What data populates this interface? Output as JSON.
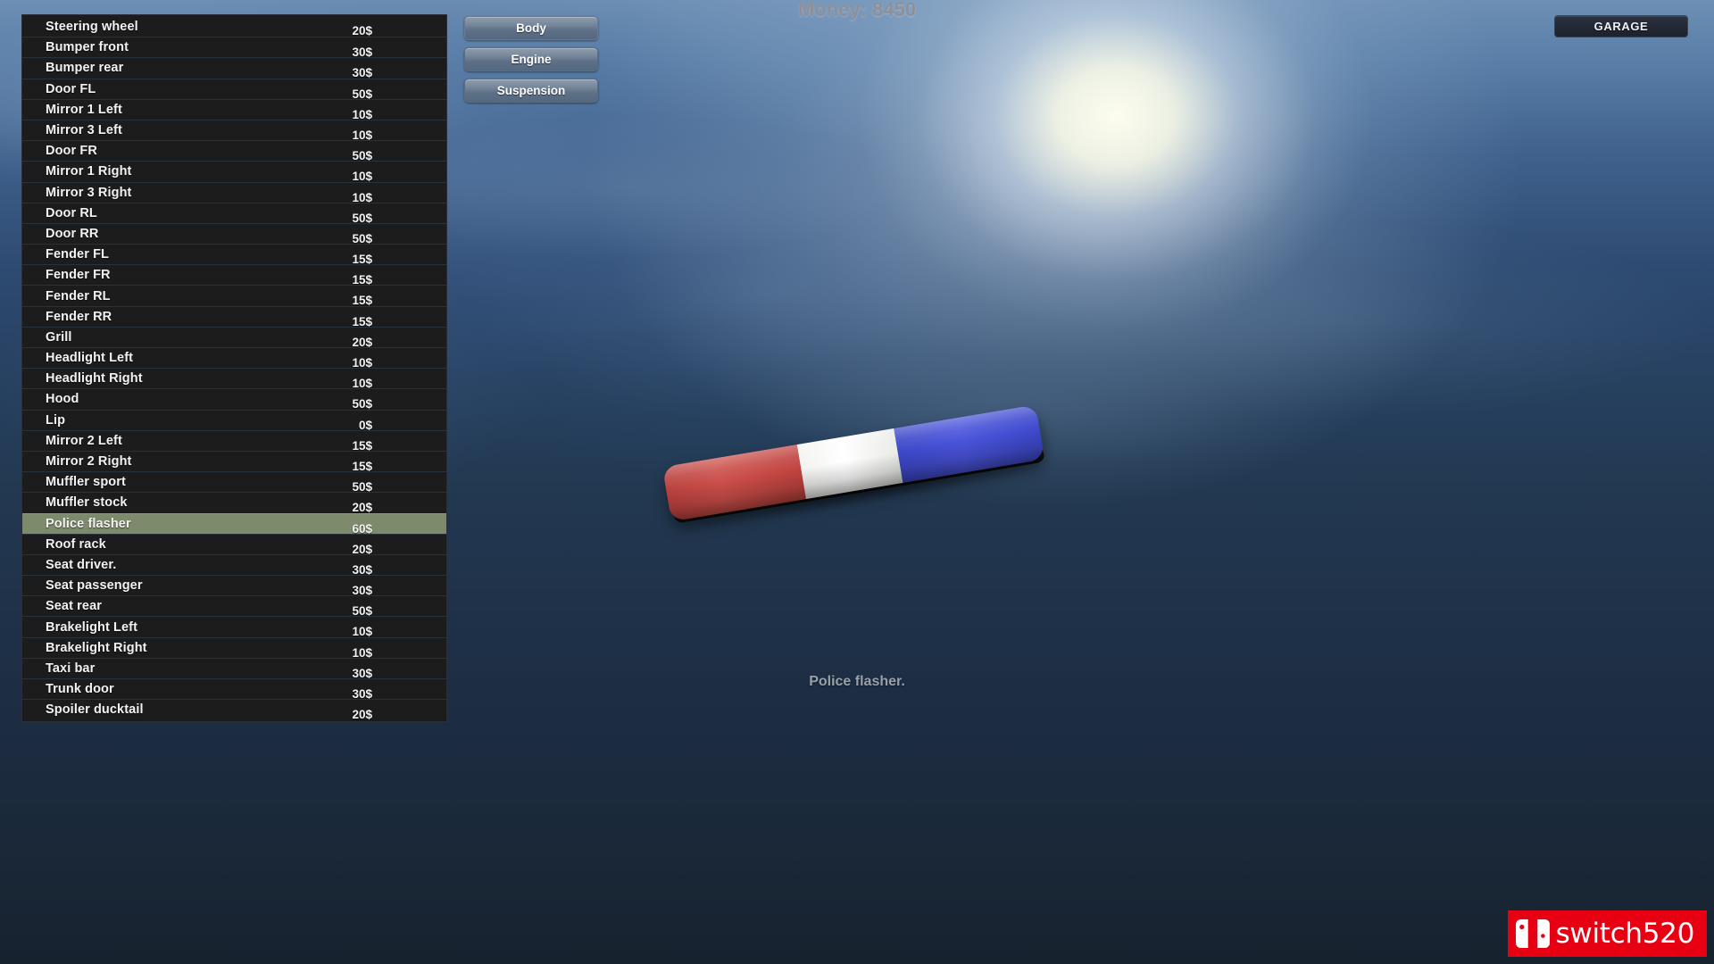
{
  "hud": {
    "money_label": "Money: 8450",
    "garage_button": "GARAGE",
    "selected_part_caption": "Police flasher."
  },
  "categories": [
    {
      "label": "Body",
      "active": true
    },
    {
      "label": "Engine",
      "active": false
    },
    {
      "label": "Suspension",
      "active": false
    }
  ],
  "parts_list": {
    "selected_index": 24,
    "rows": [
      {
        "name": "Steering wheel",
        "price": "20$"
      },
      {
        "name": "Bumper front",
        "price": "30$"
      },
      {
        "name": "Bumper rear",
        "price": "30$"
      },
      {
        "name": "Door FL",
        "price": "50$"
      },
      {
        "name": "Mirror 1 Left",
        "price": "10$"
      },
      {
        "name": "Mirror 3 Left",
        "price": "10$"
      },
      {
        "name": "Door FR",
        "price": "50$"
      },
      {
        "name": "Mirror 1 Right",
        "price": "10$"
      },
      {
        "name": "Mirror 3 Right",
        "price": "10$"
      },
      {
        "name": "Door RL",
        "price": "50$"
      },
      {
        "name": "Door RR",
        "price": "50$"
      },
      {
        "name": "Fender FL",
        "price": "15$"
      },
      {
        "name": "Fender FR",
        "price": "15$"
      },
      {
        "name": "Fender RL",
        "price": "15$"
      },
      {
        "name": "Fender RR",
        "price": "15$"
      },
      {
        "name": "Grill",
        "price": "20$"
      },
      {
        "name": "Headlight Left",
        "price": "10$"
      },
      {
        "name": "Headlight Right",
        "price": "10$"
      },
      {
        "name": "Hood",
        "price": "50$"
      },
      {
        "name": "Lip",
        "price": "0$"
      },
      {
        "name": "Mirror 2 Left",
        "price": "15$"
      },
      {
        "name": "Mirror 2 Right",
        "price": "15$"
      },
      {
        "name": "Muffler sport",
        "price": "50$"
      },
      {
        "name": "Muffler stock",
        "price": "20$"
      },
      {
        "name": "Police flasher",
        "price": "60$"
      },
      {
        "name": "Roof rack",
        "price": "20$"
      },
      {
        "name": "Seat driver.",
        "price": "30$"
      },
      {
        "name": "Seat passenger",
        "price": "30$"
      },
      {
        "name": "Seat rear",
        "price": "50$"
      },
      {
        "name": "Brakelight Left",
        "price": "10$"
      },
      {
        "name": "Brakelight Right",
        "price": "10$"
      },
      {
        "name": "Taxi bar",
        "price": "30$"
      },
      {
        "name": "Trunk door",
        "price": "30$"
      },
      {
        "name": "Spoiler ducktail",
        "price": "20$"
      }
    ]
  },
  "preview": {
    "object_name": "police-flasher-lightbar",
    "segments": [
      {
        "name": "red",
        "color": "#c64a46"
      },
      {
        "name": "white",
        "color": "#ffffff"
      },
      {
        "name": "blue",
        "color": "#454fd4"
      }
    ]
  },
  "watermark": {
    "text": "switch520",
    "background": "#e60012"
  },
  "colors": {
    "row_background": "#1c1c1c",
    "row_selected": "#7d8a6b",
    "text": "#f2f2f2",
    "money_text": "#8d9098",
    "caption_text": "#9aa0a8"
  }
}
